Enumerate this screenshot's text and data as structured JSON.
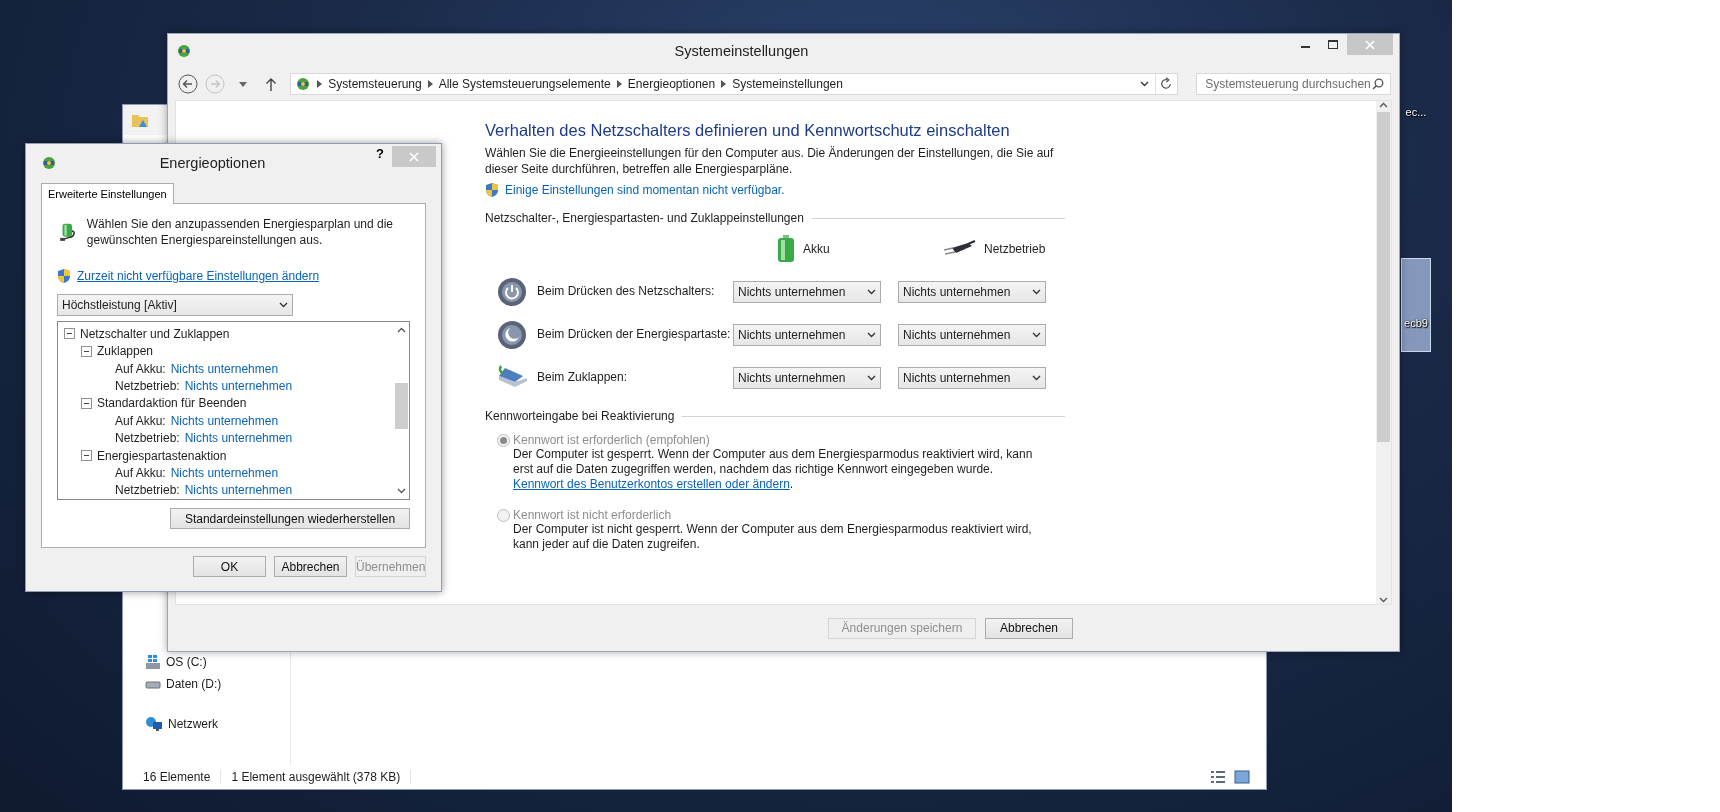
{
  "desktop_icons": [
    {
      "label": "ec...",
      "selected": false
    },
    {
      "label": "ecb9",
      "selected": true
    }
  ],
  "explorer": {
    "nav_items": [
      {
        "label": "OS (C:)",
        "kind": "system-drive"
      },
      {
        "label": "Daten (D:)",
        "kind": "drive"
      },
      {
        "label": "Netzwerk",
        "kind": "network"
      }
    ],
    "status": [
      "16 Elemente",
      "1 Element ausgewählt (378 KB)"
    ]
  },
  "main_window": {
    "title": "Systemeinstellungen",
    "breadcrumb": [
      "Systemsteuerung",
      "Alle Systemsteuerungselemente",
      "Energieoptionen",
      "Systemeinstellungen"
    ],
    "search": {
      "placeholder": "Systemsteuerung durchsuchen"
    },
    "heading": "Verhalten des Netzschalters definieren und Kennwortschutz einschalten",
    "description": "Wählen Sie die Energieeinstellungen für den Computer aus. Die Änderungen der Einstellungen, die Sie auf dieser Seite durchführen, betreffen alle Energiesparpläne.",
    "admin_link": "Einige Einstellungen sind momentan nicht verfügbar.",
    "button_section": {
      "title": "Netzschalter-, Energiespartasten- und Zuklappeinstellungen",
      "columns": [
        {
          "label": "Akku",
          "kind": "battery"
        },
        {
          "label": "Netzbetrieb",
          "kind": "plug"
        }
      ],
      "rows": [
        {
          "kind": "power",
          "label": "Beim Drücken des Netzschalters:",
          "values": [
            "Nichts unternehmen",
            "Nichts unternehmen"
          ]
        },
        {
          "kind": "sleep",
          "label": "Beim Drücken der Energiespartaste:",
          "values": [
            "Nichts unternehmen",
            "Nichts unternehmen"
          ]
        },
        {
          "kind": "lid",
          "label": "Beim Zuklappen:",
          "values": [
            "Nichts unternehmen",
            "Nichts unternehmen"
          ]
        }
      ]
    },
    "password_section": {
      "title": "Kennworteingabe bei Reaktivierung",
      "options": [
        {
          "label": "Kennwort ist erforderlich (empfohlen)",
          "selected": true,
          "disabled": true,
          "description": "Der Computer ist gesperrt. Wenn der Computer aus dem Energiesparmodus reaktiviert wird, kann erst auf die Daten zugegriffen werden, nachdem das richtige Kennwort eingegeben wurde.",
          "link": "Kennwort des Benutzerkontos erstellen oder ändern",
          "link_suffix": "."
        },
        {
          "label": "Kennwort ist nicht erforderlich",
          "selected": false,
          "disabled": true,
          "description": "Der Computer ist nicht gesperrt. Wenn der Computer aus dem Energiesparmodus reaktiviert wird, kann jeder auf die Daten zugreifen."
        }
      ]
    },
    "buttons": [
      {
        "label": "Änderungen speichern",
        "disabled": true
      },
      {
        "label": "Abbrechen",
        "disabled": false
      }
    ]
  },
  "dialog": {
    "title": "Energieoptionen",
    "help": "?",
    "tabs": [
      {
        "label": "Erweiterte Einstellungen",
        "selected": true
      }
    ],
    "description": "Wählen Sie den anzupassenden Energiesparplan und die gewünschten Energiespareinstellungen aus.",
    "admin_link": "Zurzeit nicht verfügbare Einstellungen ändern",
    "plan": {
      "value": "Höchstleistung [Aktiv]"
    },
    "tree": [
      {
        "label": "Netzschalter und Zuklappen",
        "expanded": true,
        "children": [
          {
            "label": "Zuklappen",
            "expanded": true,
            "settings": [
              {
                "name": "Auf Akku:",
                "value": "Nichts unternehmen"
              },
              {
                "name": "Netzbetrieb:",
                "value": "Nichts unternehmen"
              }
            ]
          },
          {
            "label": "Standardaktion für Beenden",
            "expanded": true,
            "settings": [
              {
                "name": "Auf Akku:",
                "value": "Nichts unternehmen"
              },
              {
                "name": "Netzbetrieb:",
                "value": "Nichts unternehmen"
              }
            ]
          },
          {
            "label": "Energiespartastenaktion",
            "expanded": true,
            "settings": [
              {
                "name": "Auf Akku:",
                "value": "Nichts unternehmen"
              },
              {
                "name": "Netzbetrieb:",
                "value": "Nichts unternehmen"
              }
            ]
          }
        ]
      }
    ],
    "restore_button": "Standardeinstellungen wiederherstellen",
    "buttons": [
      {
        "label": "OK",
        "disabled": false
      },
      {
        "label": "Abbrechen",
        "disabled": false
      },
      {
        "label": "Übernehmen",
        "disabled": true
      }
    ]
  }
}
